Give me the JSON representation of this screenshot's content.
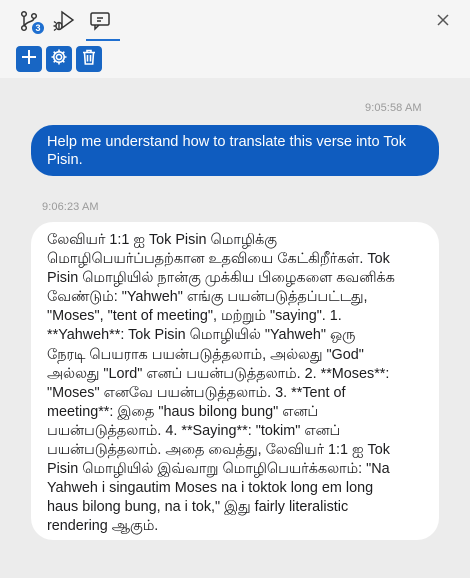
{
  "tabs": [
    {
      "icon": "source-control-icon",
      "badge": "3"
    },
    {
      "icon": "debug-icon"
    },
    {
      "icon": "chat-icon",
      "active": true
    }
  ],
  "toolbar": {
    "buttons": [
      {
        "icon": "plus-icon"
      },
      {
        "icon": "gear-icon"
      },
      {
        "icon": "trash-icon"
      }
    ]
  },
  "messages": [
    {
      "role": "user",
      "time": "9:05:58 AM",
      "text": "Help me understand how to translate this verse into Tok Pisin."
    },
    {
      "role": "assistant",
      "time": "9:06:23 AM",
      "text": "லேவியர் 1:1 ஐ Tok Pisin மொழிக்கு\nமொழிபெயர்ப்பதற்கான உதவியை கேட்கிறீர்கள். Tok\nPisin மொழியில் நான்கு முக்கிய பிழைகளை கவனிக்க\nவேண்டும்: \"Yahweh\" எங்கு பயன்படுத்தப்பட்டது,\n\"Moses\", \"tent of meeting\", மற்றும் \"saying\". 1.\n**Yahweh**: Tok Pisin மொழியில் \"Yahweh\" ஒரு\nநேரடி பெயராக பயன்படுத்தலாம், அல்லது \"God\"\nஅல்லது \"Lord\" எனப் பயன்படுத்தலாம். 2. **Moses**:\n\"Moses\" எனவே பயன்படுத்தலாம். 3. **Tent of\nmeeting**: இதை \"haus bilong bung\" எனப்\nபயன்படுத்தலாம். 4. **Saying**: \"tokim\" எனப்\nபயன்படுத்தலாம். அதை வைத்து, லேவியர் 1:1 ஐ Tok\nPisin மொழியில் இவ்வாறு மொழிபெயர்க்கலாம்: \"Na\nYahweh i singautim Moses na i toktok long em long\nhaus bilong bung, na i tok,\" இது fairly literalistic\nrendering ஆகும்."
    }
  ],
  "colors": {
    "accent": "#1f6fd0",
    "user_bubble": "#0f5cbf",
    "background": "#ececec"
  }
}
